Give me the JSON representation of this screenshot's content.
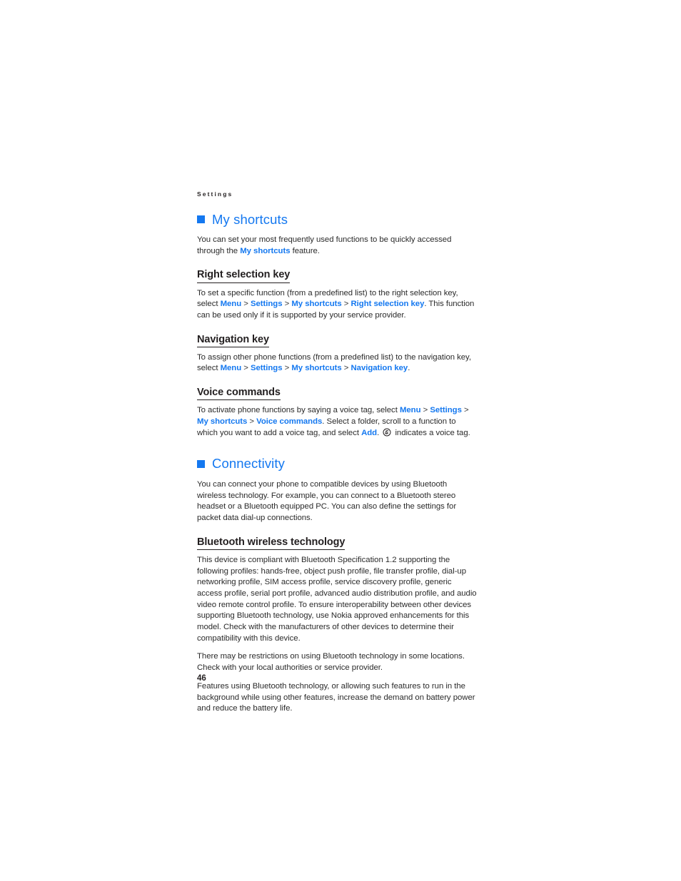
{
  "document": {
    "running_header": "Settings",
    "page_number": "46"
  },
  "colors": {
    "accent_blue": "#1478f0",
    "body_text": "#2b2b2b",
    "heading_text": "#231f20"
  },
  "sections": [
    {
      "id": "my-shortcuts",
      "heading": "My shortcuts",
      "intro": {
        "part1": "You can set your most frequently used functions to be quickly accessed through the ",
        "link1": "My shortcuts",
        "part2": " feature."
      },
      "subsections": [
        {
          "id": "right-selection-key",
          "heading": "Right selection key",
          "text": {
            "part1": "To set a specific function (from a predefined list) to the right selection key, select ",
            "link1": "Menu",
            "sep1": " > ",
            "link2": "Settings",
            "sep2": " > ",
            "link3": "My shortcuts",
            "sep3": " > ",
            "link4": "Right selection key",
            "part2": ". This function can be used only if it is supported by your service provider."
          }
        },
        {
          "id": "navigation-key",
          "heading": "Navigation key",
          "text": {
            "part1": "To assign other phone functions (from a predefined list) to the navigation key, select ",
            "link1": "Menu",
            "sep1": " > ",
            "link2": "Settings",
            "sep2": " > ",
            "link3": "My shortcuts",
            "sep3": " > ",
            "link4": "Navigation key",
            "part2": "."
          }
        },
        {
          "id": "voice-commands",
          "heading": "Voice commands",
          "text": {
            "part1": "To activate phone functions by saying a voice tag, select ",
            "link1": "Menu",
            "sep1": " > ",
            "link2": "Settings",
            "sep2": " > ",
            "link3": "My shortcuts",
            "sep3": " > ",
            "link4": "Voice commands",
            "part2": ". Select a folder, scroll to a function to which you want to add a voice tag, and select ",
            "link5": "Add",
            "part3": ". ",
            "icon": "voice-tag-icon",
            "part4": " indicates a voice tag."
          }
        }
      ]
    },
    {
      "id": "connectivity",
      "heading": "Connectivity",
      "intro": {
        "part1": "You can connect your phone to compatible devices by using Bluetooth wireless technology. For example, you can connect to a Bluetooth stereo headset or a Bluetooth equipped PC. You can also define the settings for packet data dial-up connections."
      },
      "subsections": [
        {
          "id": "bluetooth-wireless-technology",
          "heading": "Bluetooth wireless technology",
          "paragraphs": [
            "This device is compliant with Bluetooth Specification 1.2 supporting the following profiles: hands-free, object push profile, file transfer profile, dial-up networking profile, SIM access profile, service discovery profile, generic access profile, serial port profile, advanced audio distribution profile, and audio video remote control profile. To ensure interoperability between other devices supporting Bluetooth technology, use Nokia approved enhancements for this model. Check with the manufacturers of other devices to determine their compatibility with this device.",
            "There may be restrictions on using Bluetooth technology in some locations. Check with your local authorities or service provider.",
            "Features using Bluetooth technology, or allowing such features to run in the background while using other features, increase the demand on battery power and reduce the battery life."
          ]
        }
      ]
    }
  ]
}
